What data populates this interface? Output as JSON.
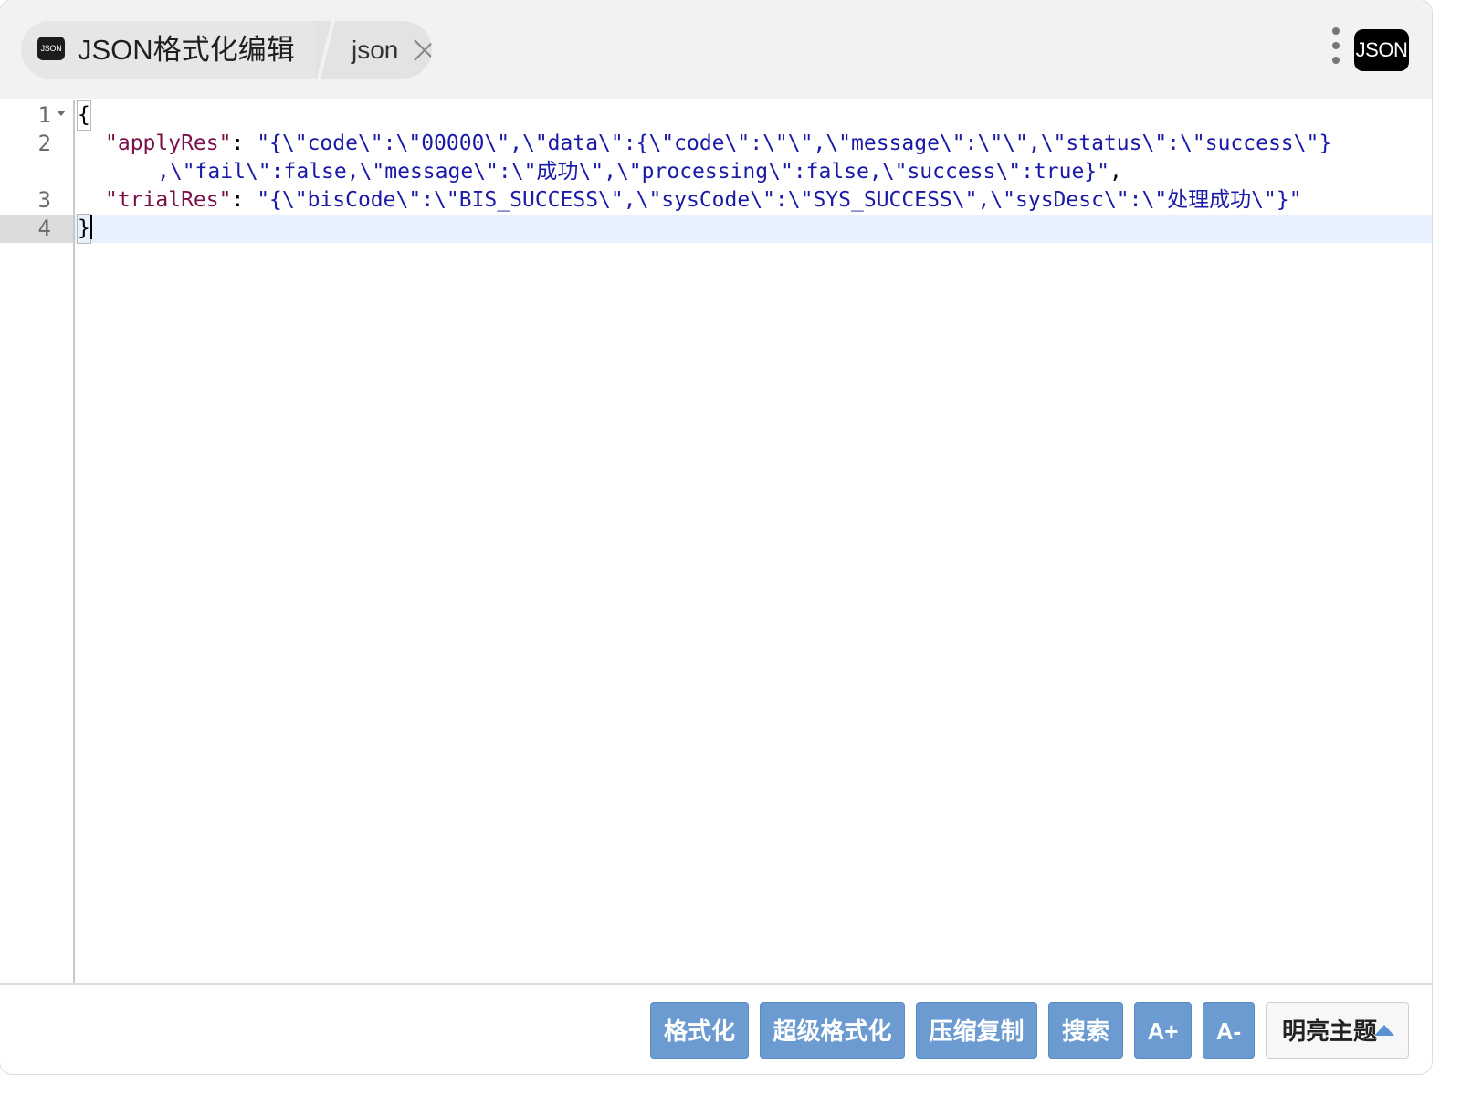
{
  "header": {
    "app_icon_text": "JSON",
    "title": "JSON格式化编辑",
    "sub_tab": "json",
    "badge": "JSON"
  },
  "editor": {
    "line_numbers": [
      "1",
      "2",
      "3",
      "4"
    ],
    "lines": {
      "l1": "{",
      "l2_key": "\"applyRes\"",
      "l2_colon": ": ",
      "l2_val_a": "\"{\\\"code\\\":\\\"00000\\\",\\\"data\\\":{\\\"code\\\":\\\"\\\",\\\"message\\\":\\\"\\\",\\\"status\\\":\\\"success\\\"}",
      "l2_val_b": ",\\\"fail\\\":false,\\\"message\\\":\\\"成功\\\",\\\"processing\\\":false,\\\"success\\\":true}\"",
      "l2_comma": ",",
      "l3_key": "\"trialRes\"",
      "l3_colon": ": ",
      "l3_val": "\"{\\\"bisCode\\\":\\\"BIS_SUCCESS\\\",\\\"sysCode\\\":\\\"SYS_SUCCESS\\\",\\\"sysDesc\\\":\\\"处理成功\\\"}\"",
      "l4": "}"
    }
  },
  "toolbar": {
    "format": "格式化",
    "super_format": "超级格式化",
    "compress_copy": "压缩复制",
    "search": "搜索",
    "font_increase": "A+",
    "font_decrease": "A-",
    "theme": "明亮主题"
  },
  "colors": {
    "header_bg": "#f2f2f2",
    "button_bg": "#6b9bd1",
    "key_color": "#7a0f4a",
    "string_color": "#1a1aa6",
    "active_line": "#e8f2fe"
  }
}
